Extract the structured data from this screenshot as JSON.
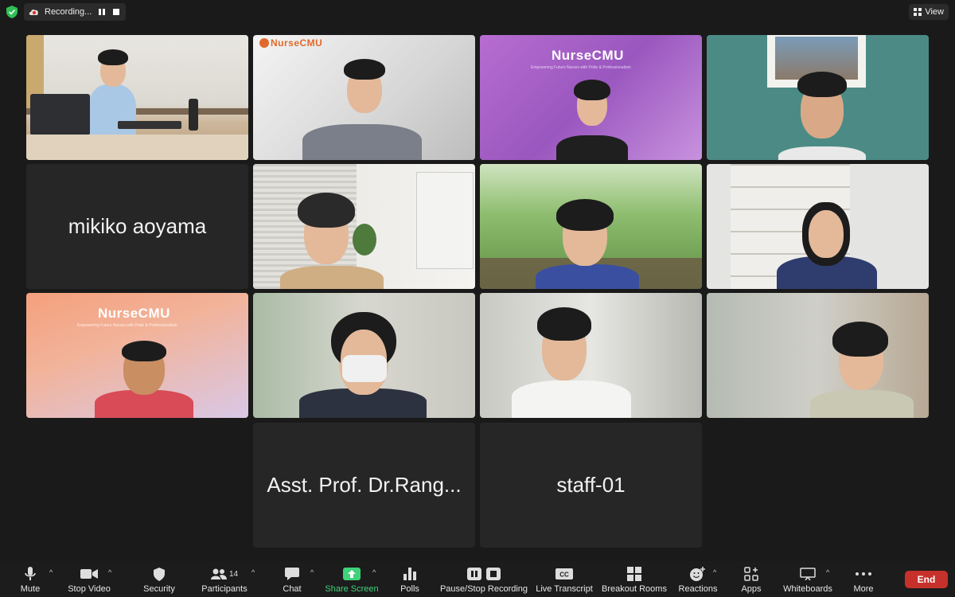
{
  "topbar": {
    "recording_label": "Recording...",
    "view_label": "View"
  },
  "tiles": {
    "nursecmu_brand": "NurseCMU",
    "nursecmu_tagline": "Empowering Future Nurses with Pride & Professionalism",
    "name_1": "mikiko aoyama",
    "name_2": "Asst. Prof. Dr.Rang...",
    "name_3": "staff-01"
  },
  "toolbar": {
    "mute": "Mute",
    "stop_video": "Stop Video",
    "security": "Security",
    "participants": "Participants",
    "participants_count": "14",
    "chat": "Chat",
    "share_screen": "Share Screen",
    "polls": "Polls",
    "pause_stop_recording": "Pause/Stop Recording",
    "live_transcript": "Live Transcript",
    "breakout_rooms": "Breakout Rooms",
    "reactions": "Reactions",
    "apps": "Apps",
    "whiteboards": "Whiteboards",
    "more": "More",
    "end": "End"
  },
  "colors": {
    "active_speaker": "#5ad15a",
    "share_green": "#3fd27a",
    "end_red": "#c7312b"
  }
}
